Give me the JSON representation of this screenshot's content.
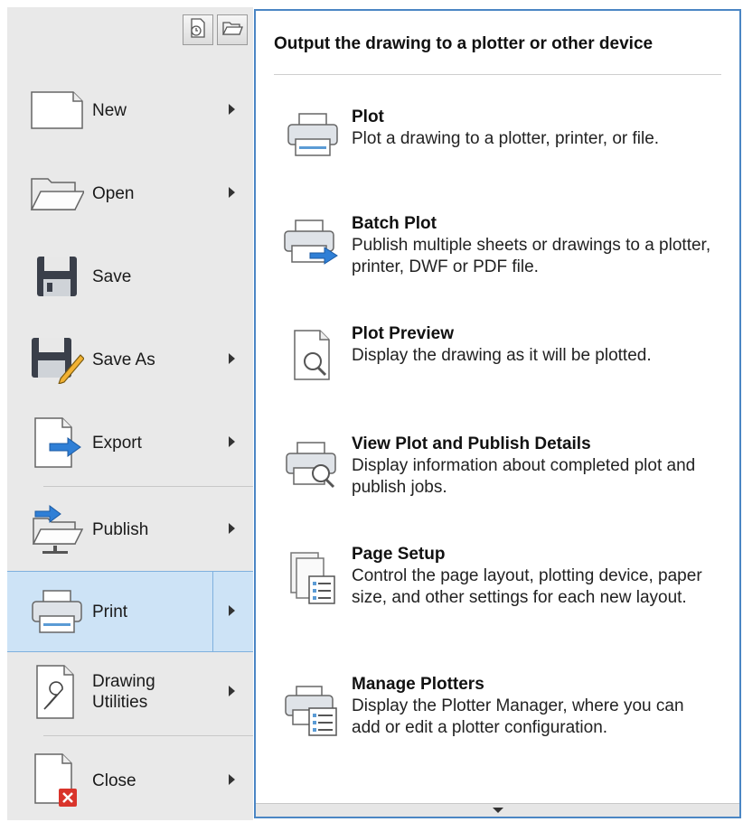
{
  "menu": {
    "items": [
      {
        "label": "New",
        "icon": "new-document-icon",
        "has_submenu": true
      },
      {
        "label": "Open",
        "icon": "folder-open-icon",
        "has_submenu": true
      },
      {
        "label": "Save",
        "icon": "floppy-disk-icon",
        "has_submenu": false
      },
      {
        "label": "Save As",
        "icon": "floppy-pencil-icon",
        "has_submenu": true
      },
      {
        "label": "Export",
        "icon": "export-arrow-icon",
        "has_submenu": true
      },
      {
        "label": "Publish",
        "icon": "publish-folder-icon",
        "has_submenu": true
      },
      {
        "label": "Print",
        "icon": "printer-icon",
        "has_submenu": true,
        "active": true
      },
      {
        "label": "Drawing Utilities",
        "icon": "wrench-icon",
        "has_submenu": true
      },
      {
        "label": "Close",
        "icon": "close-document-icon",
        "has_submenu": true
      }
    ]
  },
  "panel": {
    "heading": "Output the drawing to a plotter or other device",
    "entries": [
      {
        "title": "Plot",
        "description": "Plot a drawing to a plotter, printer, or file.",
        "icon": "printer-icon"
      },
      {
        "title": "Batch Plot",
        "description": "Publish multiple sheets or drawings to a plotter, printer, DWF or PDF file.",
        "icon": "batch-plot-icon"
      },
      {
        "title": "Plot Preview",
        "description": "Display the drawing as it will be plotted.",
        "icon": "plot-preview-icon"
      },
      {
        "title": "View Plot and Publish Details",
        "description": "Display information about completed plot and publish jobs.",
        "icon": "plot-details-icon"
      },
      {
        "title": "Page Setup",
        "description": "Control the page layout, plotting device, paper size, and other settings for each new layout.",
        "icon": "page-setup-icon"
      },
      {
        "title": "Manage Plotters",
        "description": "Display the Plotter Manager, where you can add or edit a plotter configuration.",
        "icon": "plotter-manager-icon"
      }
    ]
  },
  "colors": {
    "accent": "#4b86c4",
    "active_bg": "#cde3f6",
    "menu_bg": "#e9e9e9"
  }
}
